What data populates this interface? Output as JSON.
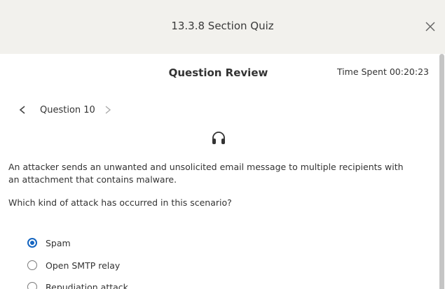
{
  "window": {
    "title": "13.3.8 Section Quiz",
    "close_icon": "close-icon"
  },
  "review": {
    "title": "Question Review",
    "time_spent": "Time Spent 00:20:23"
  },
  "navigation": {
    "question_label": "Question 10",
    "prev_icon": "chevron-left-icon",
    "next_icon": "chevron-right-icon"
  },
  "question": {
    "audio_icon": "headphones-icon",
    "text": "An attacker sends an unwanted and unsolicited email message to multiple recipients with an attachment that contains malware.",
    "prompt": "Which kind of attack has occurred in this scenario?",
    "options": [
      {
        "label": "Spam",
        "selected": true
      },
      {
        "label": "Open SMTP relay",
        "selected": false
      },
      {
        "label": "Repudiation attack",
        "selected": false
      }
    ]
  },
  "colors": {
    "header_bg": "#f2f1ed",
    "accent": "#1565c0",
    "text": "#333333"
  }
}
